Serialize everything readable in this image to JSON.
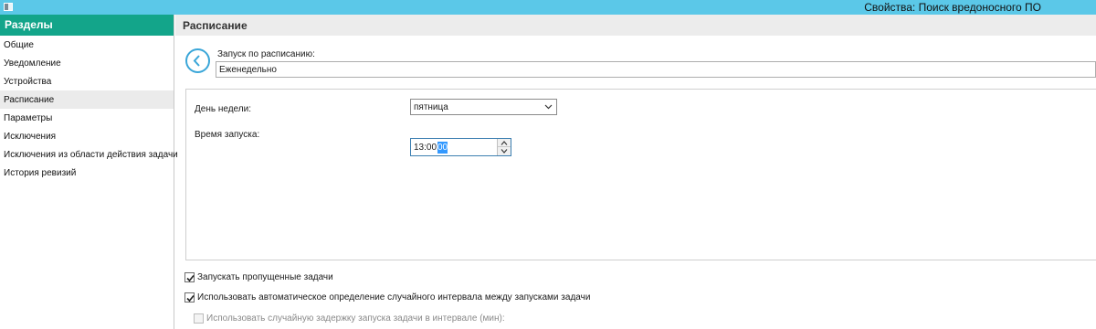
{
  "window": {
    "title": "Свойства: Поиск вредоносного ПО",
    "icon": "window-icon"
  },
  "sidebar": {
    "header": "Разделы",
    "items": [
      {
        "label": "Общие",
        "active": false
      },
      {
        "label": "Уведомление",
        "active": false
      },
      {
        "label": "Устройства",
        "active": false
      },
      {
        "label": "Расписание",
        "active": true
      },
      {
        "label": "Параметры",
        "active": false
      },
      {
        "label": "Исключения",
        "active": false
      },
      {
        "label": "Исключения из области действия задачи",
        "active": false
      },
      {
        "label": "История ревизий",
        "active": false
      }
    ]
  },
  "main": {
    "title": "Расписание",
    "back_icon": "back-arrow-icon",
    "schedule_label": "Запуск по расписанию:",
    "schedule_value": "Еженедельно",
    "weekday_label": "День недели:",
    "weekday_value": "пятница",
    "time_label": "Время запуска:",
    "time_hm": "13:00:",
    "time_sec": "00",
    "checkboxes": [
      {
        "label": "Запускать пропущенные задачи",
        "checked": true,
        "enabled": true
      },
      {
        "label": "Использовать автоматическое определение случайного интервала между запусками задачи",
        "checked": true,
        "enabled": true
      },
      {
        "label": "Использовать случайную задержку запуска задачи в интервале (мин):",
        "checked": false,
        "enabled": false
      }
    ]
  },
  "colors": {
    "titlebar": "#5bc8e8",
    "sidebar_header": "#13a58a",
    "accent": "#3aa6d8",
    "selection": "#3399ff"
  }
}
